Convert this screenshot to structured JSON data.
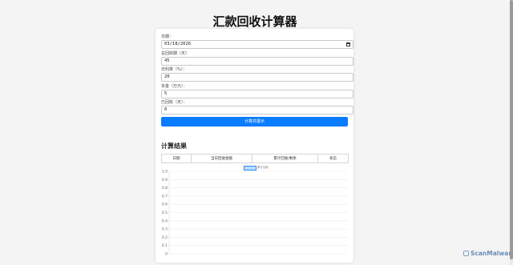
{
  "page": {
    "title": "汇款回收计算器"
  },
  "form": {
    "fields": [
      {
        "label": "日期：",
        "value": "03/18/2026",
        "type": "date"
      },
      {
        "label": "总回收期（天）",
        "value": "45"
      },
      {
        "label": "日利率（%）：",
        "value": "20"
      },
      {
        "label": "本金（万元）：",
        "value": "5"
      },
      {
        "label": "已回收（天）：",
        "value": "0"
      }
    ],
    "submit_label": "计算并展示"
  },
  "results": {
    "heading": "计算结果",
    "columns": [
      "日期",
      "当日回收金额",
      "累计回收/剩余",
      "状态"
    ]
  },
  "chart_data": {
    "type": "line",
    "series": [
      {
        "name": "回收金额",
        "values": []
      }
    ],
    "legend_secondary": "累计回收",
    "y_ticks": [
      "1.0",
      "0.9",
      "0.8",
      "0.7",
      "0.6",
      "0.5",
      "0.4",
      "0.3",
      "0.2",
      "0.1",
      "0"
    ],
    "ylim": [
      0,
      1
    ],
    "grid": true,
    "legend_position": "top-center",
    "series_color": "#2f8ef0"
  },
  "watermark": {
    "text": "ScanMalware",
    "icon": "shield-icon",
    "color": "#6b8fb3"
  }
}
